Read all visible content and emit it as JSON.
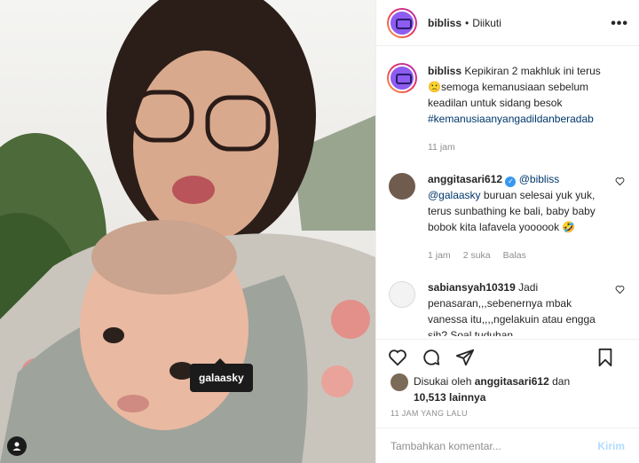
{
  "photo": {
    "alt_subject": "selfie photo",
    "tag_label": "galaasky"
  },
  "header": {
    "username": "bibliss",
    "separator": "•",
    "follow_state": "Diikuti",
    "more_label": "•••"
  },
  "caption": {
    "username": "bibliss",
    "text": "Kepikiran 2 makhluk ini terus 🙁semoga kemanusiaan sebelum keadilan untuk sidang besok",
    "hashtag": "#kemanusiaanyangadildanberadab",
    "time": "11 jam"
  },
  "comments": [
    {
      "username": "anggitasari612",
      "mention": "@bibliss",
      "mention2": "@galaasky",
      "text": "buruan selesai yuk yuk, terus sunbathing ke bali, baby baby bobok kita lafavela yoooook 🤣",
      "time": "1 jam",
      "likes": "2 suka",
      "reply": "Balas"
    },
    {
      "username": "sabiansyah10319",
      "text": "Jadi penasaran,,,sebenernya mbak vanessa itu,,,,ngelakuin atau engga sih? Soal tuduhan"
    }
  ],
  "likes": {
    "prefix": "Disukai oleh",
    "user": "anggitasari612",
    "conj": "dan",
    "others": "10,513 lainnya"
  },
  "time_ago": "11 JAM YANG LALU",
  "composer": {
    "placeholder": "Tambahkan komentar...",
    "post_label": "Kirim"
  },
  "colors": {
    "link": "#00376b",
    "muted": "#8e8e8e",
    "post_button": "#b3dbff",
    "verified": "#3897f0"
  }
}
